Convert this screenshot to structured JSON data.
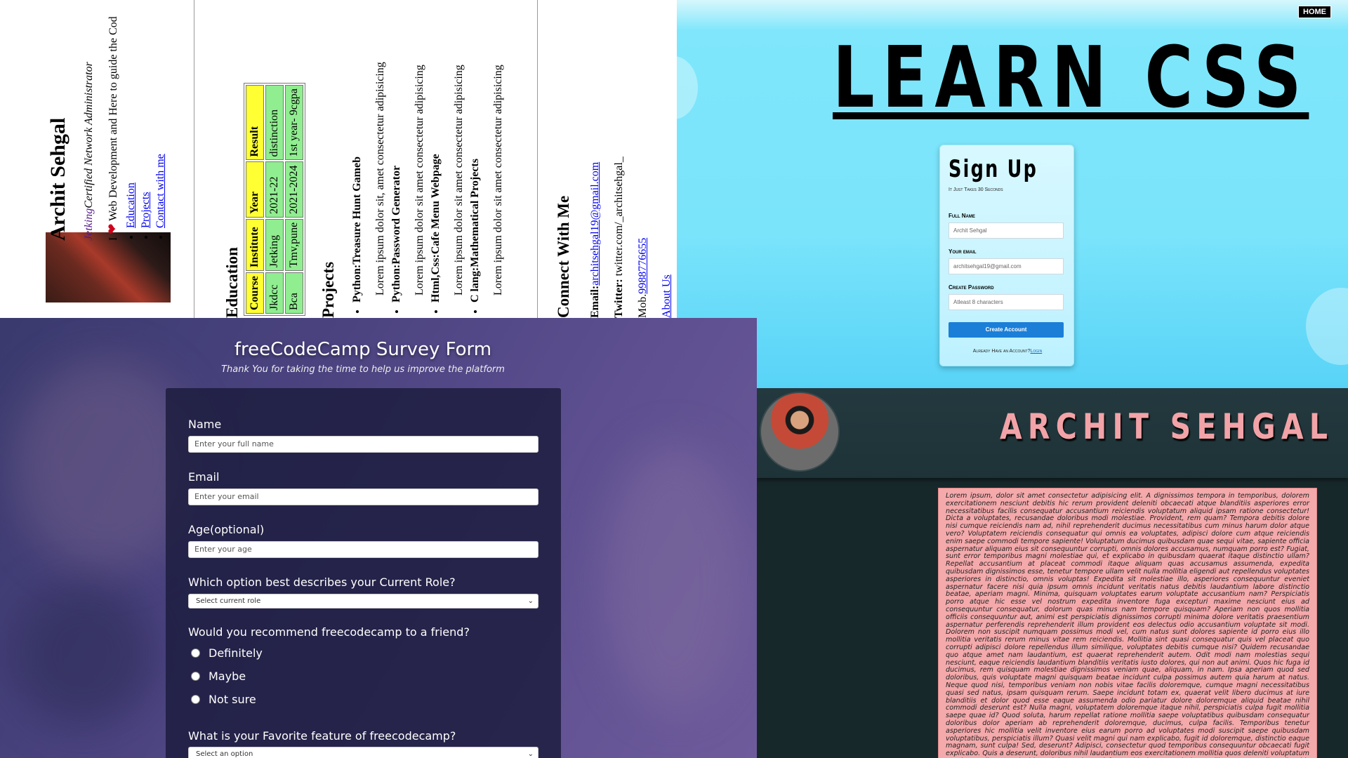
{
  "resume": {
    "name": "Archit Sehgal",
    "role_link": "Jetking",
    "role_text": "Certified Network Administrator",
    "tag_prefix": "I",
    "tag_heart": "❤",
    "tagline": "Web Development and Here to guide the Cod",
    "nav": [
      "Education",
      "Projects",
      "Contact with me"
    ],
    "education_heading": "Education",
    "table_headers": [
      "Course",
      "Institute",
      "Year",
      "Result"
    ],
    "table_rows": [
      [
        "Jkdcc",
        "Jetking",
        "2021-22",
        "distinction"
      ],
      [
        "Bca",
        "Tmv,pune",
        "2021-2024",
        "1st year- 9cgpa"
      ]
    ],
    "projects_heading": "Projects",
    "projects": [
      {
        "title": "Python:Treasure Hunt Gameb",
        "desc": "Lorem ipsum dolor sit, amet consectetur adipisicing"
      },
      {
        "title": "Python:Password Generator",
        "desc": "Lorem ipsum dolor sit amet consectetur adipisicing"
      },
      {
        "title": "Html,Css:Cafe Menu Webpage",
        "desc": "Lorem ipsum dolor sit amet consectetur adipisicing"
      },
      {
        "title": "C lang:Mathematical Projects",
        "desc": "Lorem ipsum dolor sit amet consectetur adipisicing"
      }
    ],
    "contact_heading": "Connect With Me",
    "email_label": "Email:",
    "email": "architsehgal19@gmail.com",
    "twitter_label": "Twitter:",
    "twitter": "twitter.com/_architsehgal_",
    "mob_label": "Mob.",
    "mob": "9988776655",
    "about": "About Us"
  },
  "learn_css": {
    "home": "HOME",
    "title": "LEARN CSS",
    "signup_title": "Sign Up",
    "signup_sub": "It Just Takes 30 Seconds",
    "fields": [
      {
        "label": "Full Name",
        "value": "Archit Sehgal"
      },
      {
        "label": "Your email",
        "value": "architsehgal19@gmail.com"
      },
      {
        "label": "Create Password",
        "value": "Atleast 8 characters"
      }
    ],
    "button": "Create Account",
    "footer_text": "Already Have an Account?",
    "footer_link": "Login"
  },
  "survey": {
    "title": "freeCodeCamp Survey Form",
    "description": "Thank You for taking the time to help us improve the platform",
    "name_label": "Name",
    "name_placeholder": "Enter your full name",
    "email_label": "Email",
    "email_placeholder": "Enter your email",
    "age_label": "Age(optional)",
    "age_placeholder": "Enter your age",
    "role_label": "Which option best describes your Current Role?",
    "role_selected": "Select current role",
    "recommend_label": "Would you recommend freecodecamp to a friend?",
    "recommend_options": [
      "Definitely",
      "Maybe",
      "Not sure"
    ],
    "feature_label": "What is your Favorite feature of freecodecamp?",
    "feature_selected": "Select an option"
  },
  "profile": {
    "name": "ARCHIT SEHGAL",
    "lorem": "Lorem ipsum, dolor sit amet consectetur adipisicing elit. A dignissimos tempora in temporibus, dolorem exercitationem nesciunt debitis hic rerum provident deleniti obcaecati atque blanditiis asperiores error necessitatibus facilis consequatur accusantium reiciendis voluptatum aliquid ipsam ratione consectetur! Dicta a voluptates, recusandae doloribus modi molestiae. Provident, rem quam? Tempora debitis dolore nisi cumque reiciendis nam ad, nihil reprehenderit ducimus necessitatibus cum minus harum dolor atque vero? Voluptatem reiciendis consequatur qui omnis ea voluptates, adipisci dolore cum atque reiciendis enim saepe commodi tempore sapiente! Voluptatum ducimus quibusdam quae sequi vitae, sapiente officia aspernatur aliquam eius sit consequuntur corrupti, omnis dolores accusamus, numquam porro est? Fugiat, sunt error temporibus magni molestiae qui, et explicabo in quibusdam quaerat itaque distinctio ullam? Repellat accusantium at placeat commodi itaque aliquam quas accusamus assumenda, expedita quibusdam dignissimos esse, tenetur tempore ullam velit nulla mollitia eligendi aut repellendus voluptates asperiores in distinctio, omnis voluptas! Expedita sit molestiae illo, asperiores consequuntur eveniet aspernatur facere nisi quia ipsum omnis incidunt veritatis natus debitis laudantium labore distinctio beatae, aperiam magni. Minima, quisquam voluptates earum voluptate accusantium nam? Perspiciatis porro atque hic esse vel nostrum expedita inventore fuga excepturi maxime nesciunt eius ad consequuntur consequatur, dolorum quas minus nam tempore quisquam? Aperiam non quos mollitia officiis consequuntur aut, animi est perspiciatis dignissimos corrupti minima dolore veritatis praesentium aspernatur perferendis reprehenderit illum provident eos delectus odio accusantium voluptate sit modi. Dolorem non suscipit numquam possimus modi vel, cum natus sunt dolores sapiente id porro eius illo mollitia veritatis rerum minus vitae rem reiciendis. Mollitia sint quasi consequatur quis vel placeat quo corrupti adipisci dolore repellendus illum similique, voluptates debitis cumque nisi? Quidem recusandae quo atque amet nam laudantium, est quaerat reprehenderit autem. Odit modi nam molestias sequi nesciunt, eaque reiciendis laudantium blanditiis veritatis iusto dolores, qui non aut animi. Quos hic fuga id ducimus, rem quisquam molestiae dignissimos veniam quae, aliquam, in nam. Ipsa aperiam quod sed doloribus, quis voluptate magni quisquam beatae incidunt culpa possimus autem quia harum at natus. Neque quod nisi, temporibus veniam non nobis vitae facilis doloremque, cumque magni necessitatibus quasi sed natus, ipsam quisquam rerum. Saepe incidunt totam ex, quaerat velit libero ducimus at iure blanditiis et dolor quod esse eaque assumenda odio pariatur dolore doloremque aliquid beatae nihil commodi deserunt est? Nulla magni, voluptatem doloremque itaque nihil, perspiciatis culpa fugit mollitia saepe quae id? Quod soluta, harum repellat ratione mollitia saepe voluptatibus quibusdam consequatur doloribus dolor aperiam ab reprehenderit doloremque, ducimus, culpa facilis. Temporibus tenetur asperiores hic mollitia velit inventore eius earum porro ad voluptates modi suscipit saepe quibusdam voluptatibus, perspiciatis illum? Quasi velit magni qui nam explicabo, fugit id doloremque, distinctio eaque magnam, sunt culpa! Sed, deserunt? Adipisci, consectetur quod temporibus consequuntur obcaecati fugit explicabo. Quis a deserunt, doloribus nihil laudantium eos exercitationem mollitia quos deleniti voluptatum quod expedita quas incidunt delectus in, sed facere id eius corporis ipsum illo nemo. In eligendi nobis aliquam voluptatum natus voluptatem illum tempora. Quis doloremque possimus nihil inventore rerum."
  }
}
